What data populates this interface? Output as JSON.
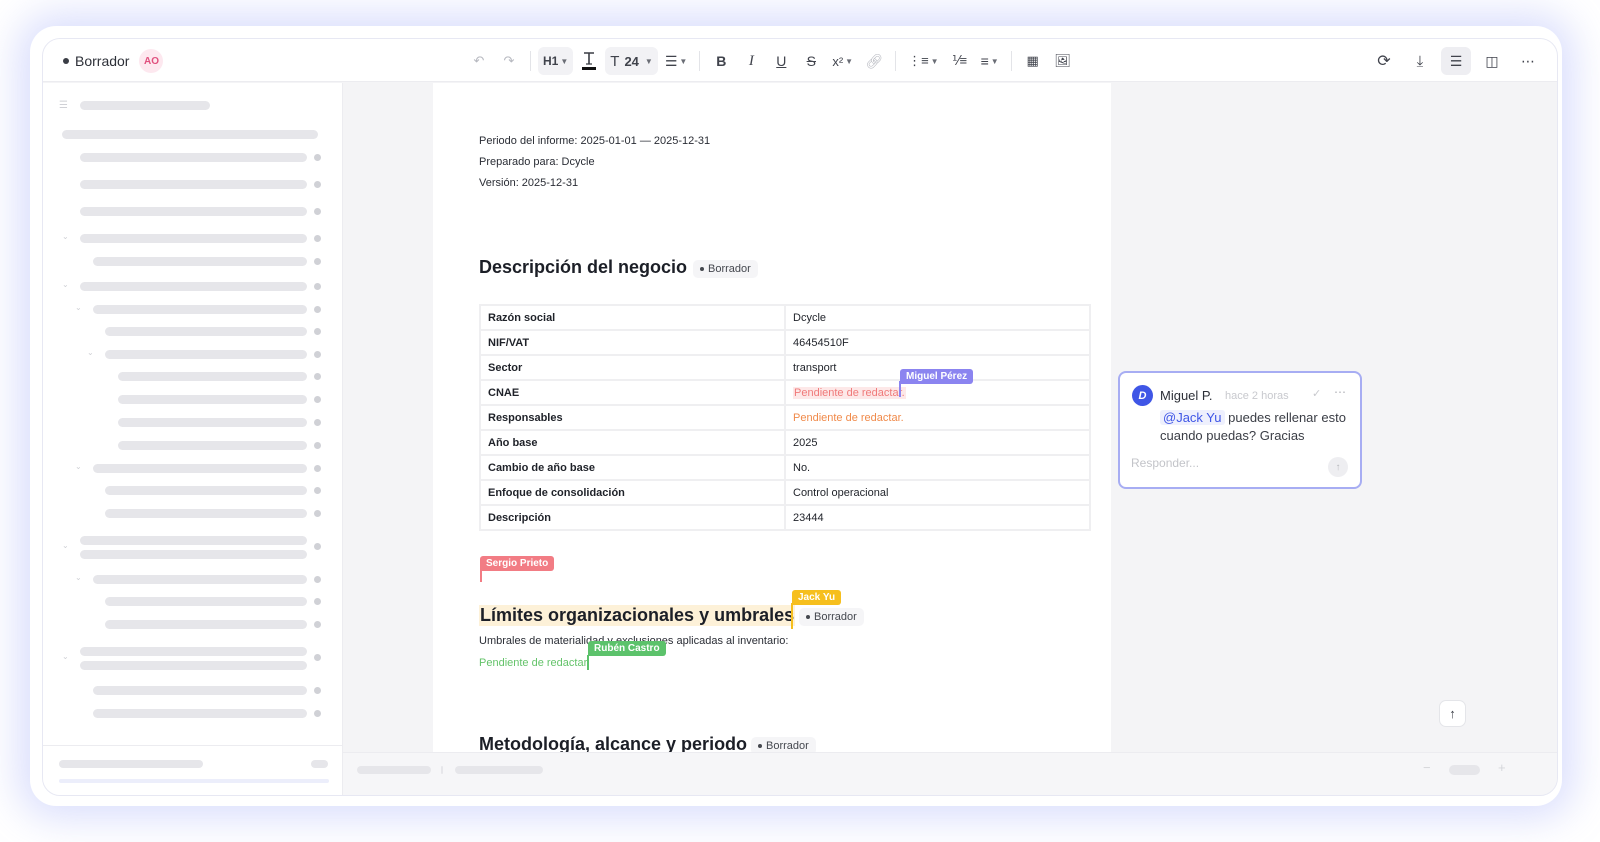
{
  "toolbar": {
    "status": "Borrador",
    "avatar_initials": "AO",
    "heading_level": "H1",
    "font_size": "24"
  },
  "document": {
    "meta": [
      "Periodo del informe: 2025-01-01 — 2025-12-31",
      "Preparado para: Dcycle",
      "Versión: 2025-12-31"
    ],
    "sections": [
      {
        "title": "Descripción del negocio",
        "badge": "Borrador"
      },
      {
        "title": "Límites organizacionales y umbrales",
        "badge": "Borrador"
      },
      {
        "title": "Metodología, alcance y periodo",
        "badge": "Borrador"
      }
    ],
    "table": [
      {
        "key": "Razón social",
        "value": "Dcycle"
      },
      {
        "key": "NIF/VAT",
        "value": "46454510F"
      },
      {
        "key": "Sector",
        "value": "transport"
      },
      {
        "key": "CNAE",
        "value": "Pendiente de redactar."
      },
      {
        "key": "Responsables",
        "value": "Pendiente de redactar."
      },
      {
        "key": "Año base",
        "value": "2025"
      },
      {
        "key": "Cambio de año base",
        "value": "No."
      },
      {
        "key": "Enfoque de consolidación",
        "value": "Control operacional"
      },
      {
        "key": "Descripción",
        "value": "23444"
      }
    ],
    "limits_text": "Umbrales de materialidad y exclusiones aplicadas al inventario:",
    "limits_pending": "Pendiente de redactar."
  },
  "collaborators": [
    {
      "name": "Miguel Pérez",
      "color": "#8b84f0"
    },
    {
      "name": "Sergio Prieto",
      "color": "#f27c84"
    },
    {
      "name": "Jack Yu",
      "color": "#f6bf1e"
    },
    {
      "name": "Rubén Castro",
      "color": "#5cc26b"
    }
  ],
  "comment": {
    "author": "Miguel P.",
    "time": "hace 2 horas",
    "mention": "@Jack Yu",
    "text": "puedes rellenar esto cuando puedas? Gracias",
    "reply_placeholder": "Responder..."
  }
}
